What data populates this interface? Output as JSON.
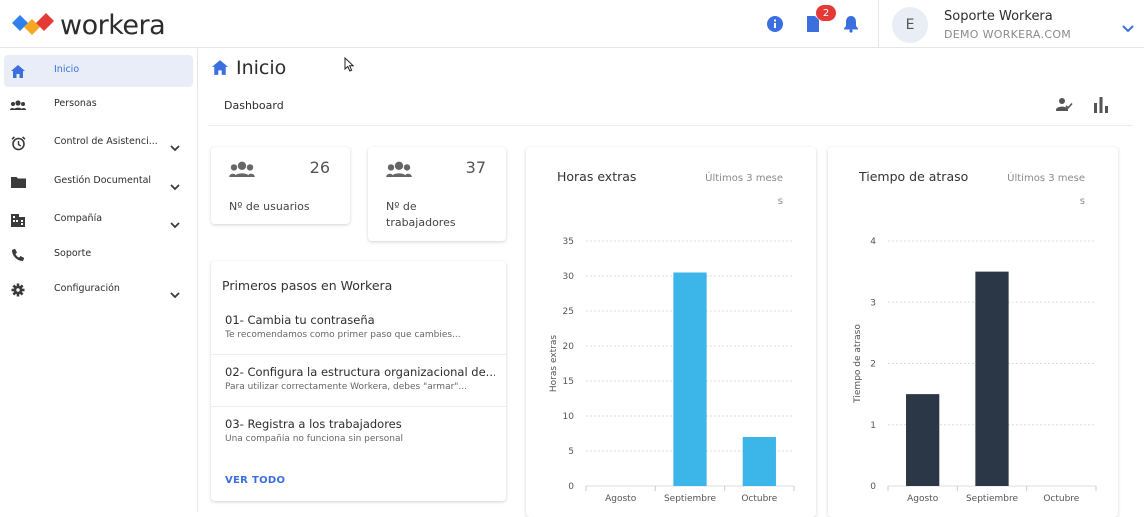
{
  "app": {
    "name": "workera",
    "notifications_badge": "2"
  },
  "user": {
    "initial": "E",
    "name": "Soporte Workera",
    "org": "DEMO WORKERA.COM"
  },
  "sidebar": {
    "items": [
      {
        "label": "Inicio",
        "icon": "home-icon",
        "active": true
      },
      {
        "label": "Personas",
        "icon": "people-icon"
      },
      {
        "label": "Control de Asistenci...",
        "icon": "alarm-icon",
        "expandable": true
      },
      {
        "label": "Gestión Documental",
        "icon": "folder-icon",
        "expandable": true
      },
      {
        "label": "Compañía",
        "icon": "building-icon",
        "expandable": true
      },
      {
        "label": "Soporte",
        "icon": "phone-icon"
      },
      {
        "label": "Configuración",
        "icon": "gear-icon",
        "expandable": true
      }
    ]
  },
  "page": {
    "title": "Inicio",
    "tab": "Dashboard"
  },
  "stats": [
    {
      "label": "Nº de usuarios",
      "value": "26"
    },
    {
      "label1": "Nº de",
      "label2": "trabajadores",
      "value": "37"
    }
  ],
  "steps": {
    "title": "Primeros pasos en Workera",
    "items": [
      {
        "title": "01- Cambia tu contraseña",
        "desc": "Te recomendamos como primer paso que cambies..."
      },
      {
        "title": "02- Configura la estructura organizacional de...",
        "desc": "Para utilizar correctamente Workera, debes \"armar\"..."
      },
      {
        "title": "03- Registra a los trabajadores",
        "desc": "Una compañía no funciona sin personal"
      }
    ],
    "see_all": "VER TODO"
  },
  "chart_data": [
    {
      "type": "bar",
      "title": "Horas extras",
      "subtitle": "Últimos 3 mese",
      "subtitle_wrap": "s",
      "ylabel": "Horas extras",
      "categories": [
        "Agosto",
        "Septiembre",
        "Octubre"
      ],
      "values": [
        0,
        30.5,
        7
      ],
      "ylim": [
        0,
        35
      ],
      "yticks": [
        0,
        5,
        10,
        15,
        20,
        25,
        30,
        35
      ],
      "color": "#3cb6e8",
      "grid": true
    },
    {
      "type": "bar",
      "title": "Tiempo de atraso",
      "subtitle": "Últimos 3 mese",
      "subtitle_wrap": "s",
      "ylabel": "Tiempo de atraso",
      "categories": [
        "Agosto",
        "Septiembre",
        "Octubre"
      ],
      "values": [
        1.5,
        3.5,
        0
      ],
      "ylim": [
        0,
        4
      ],
      "yticks": [
        0,
        1,
        2,
        3,
        4
      ],
      "color": "#2b3747",
      "grid": true
    }
  ]
}
